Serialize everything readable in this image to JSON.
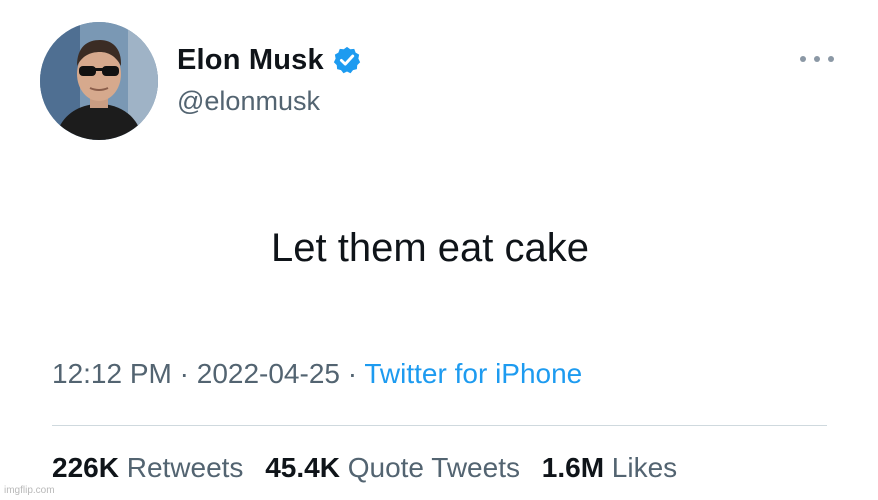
{
  "author": {
    "name": "Elon Musk",
    "handle": "@elonmusk",
    "verified": true,
    "avatar_icon": "profile-photo-avatar"
  },
  "tweet": {
    "text": "Let them eat cake",
    "time": "12:12 PM",
    "date": "2022-04-25",
    "separator": "·",
    "source": "Twitter for iPhone"
  },
  "stats": {
    "retweets_count": "226K",
    "retweets_label": "Retweets",
    "quotes_count": "45.4K",
    "quotes_label": "Quote Tweets",
    "likes_count": "1.6M",
    "likes_label": "Likes"
  },
  "watermark": "imgflip.com",
  "colors": {
    "verified_blue": "#1d9bf0",
    "link_blue": "#1d9bf0",
    "secondary_text": "#536471",
    "primary_text": "#0f1419"
  }
}
